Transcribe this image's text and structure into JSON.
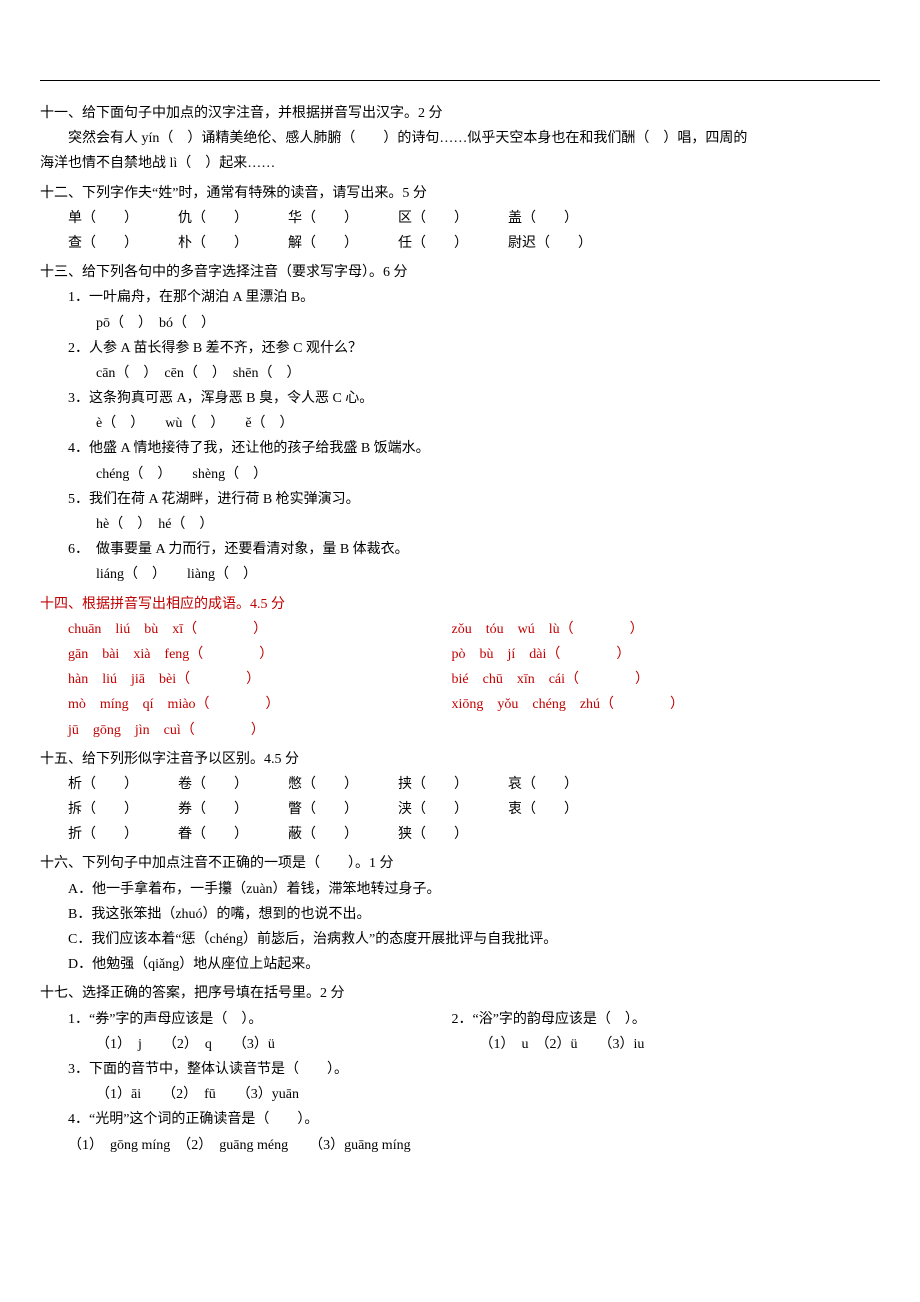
{
  "q11": {
    "title": "十一、给下面句子中加点的汉字注音，并根据拼音写出汉字。2 分",
    "line1": "突然会有人 yín（　）诵精美绝伦、感人肺腑（　　）的诗句……似乎天空本身也在和我们酬（　）唱，四周的",
    "line2": "海洋也情不自禁地战 lì（　）起来……"
  },
  "q12": {
    "title": "十二、下列字作夫“姓”时，通常有特殊的读音，请写出来。5 分",
    "row1": [
      "单（　　）",
      "仇（　　）",
      "华（　　）",
      "区（　　）",
      "盖（　　）"
    ],
    "row2": [
      "查（　　）",
      "朴（　　）",
      "解（　　）",
      "任（　　）",
      "尉迟（　　）"
    ]
  },
  "q13": {
    "title": "十三、给下列各句中的多音字选择注音（要求写字母）。6 分",
    "items": [
      {
        "q": "1．一叶扁舟，在那个湖泊 A 里漂泊 B。",
        "a": "pō（　）　bó（　）"
      },
      {
        "q": "2．人参 A 苗长得参 B 差不齐，还参 C 观什么？",
        "a": "cān（　）　cēn（　）　shēn（　）"
      },
      {
        "q": "3．这条狗真可恶 A，浑身恶 B 臭，令人恶 C 心。",
        "a": "è（　）　　wù（　）　　ě（　）"
      },
      {
        "q": "4．他盛 A 情地接待了我，还让他的孩子给我盛 B 饭端水。",
        "a": "chéng（　）　　shèng（　）"
      },
      {
        "q": "5．我们在荷 A 花湖畔，进行荷 B 枪实弹演习。",
        "a": "hè（　）　hé（　）"
      },
      {
        "q": "6．　做事要量 A 力而行，还要看清对象，量 B 体裁衣。",
        "a": "liáng（　）　　liàng（　）"
      }
    ]
  },
  "q14": {
    "title": "十四、根据拼音写出相应的成语。4.5 分",
    "rows": [
      [
        "chuān　liú　bù　xī（　　　　）",
        "zǒu　tóu　wú　lù（　　　　）"
      ],
      [
        "gān　bài　xià　feng（　　　　）",
        "pò　bù　jí　dài（　　　　）"
      ],
      [
        "hàn　liú　jiā　bèi（　　　　）",
        "bié　chū　xīn　cái（　　　　）"
      ],
      [
        "mò　míng　qí　miào（　　　　）",
        "xiōng　yǒu　chéng　zhú（　　　　）"
      ],
      [
        "jū　gōng　jìn　cuì（　　　　）",
        ""
      ]
    ]
  },
  "q15": {
    "title": "十五、给下列形似字注音予以区别。4.5 分",
    "rows": [
      [
        "析（　　）",
        "卷（　　）",
        "憋（　　）",
        "挟（　　）",
        "哀（　　）"
      ],
      [
        "拆（　　）",
        "券（　　）",
        "瞥（　　）",
        "浃（　　）",
        "衷（　　）"
      ],
      [
        "折（　　）",
        "眷（　　）",
        "蔽（　　）",
        "狭（　　）",
        ""
      ]
    ]
  },
  "q16": {
    "title": "十六、下列句子中加点注音不正确的一项是（　　）。1 分",
    "opts": [
      "A．他一手拿着布，一手攥（zuàn）着钱，滞笨地转过身子。",
      "B．我这张笨拙（zhuó）的嘴，想到的也说不出。",
      "C．我们应该本着“惩（chéng）前毖后，治病救人”的态度开展批评与自我批评。",
      "D．他勉强（qiǎng）地从座位上站起来。"
    ]
  },
  "q17": {
    "title": "十七、选择正确的答案，把序号填在括号里。2 分",
    "pair1_left_q": "1．“券”字的声母应该是（　）。",
    "pair1_right_q": "2．“浴”字的韵母应该是（　）。",
    "pair1_left_a": "（1）　j　　（2）　q　　（3）ü",
    "pair1_right_a": "（1）　u　（2）ü　　（3）iu",
    "q3": "3．下面的音节中，整体认读音节是（　　）。",
    "a3": "（1）āi　　（2）　fū　　（3）yuān",
    "q4": "4．“光明”这个词的正确读音是（　　）。",
    "a4": "（1）　gōng míng　（2）　guāng méng　　（3）guāng míng"
  }
}
